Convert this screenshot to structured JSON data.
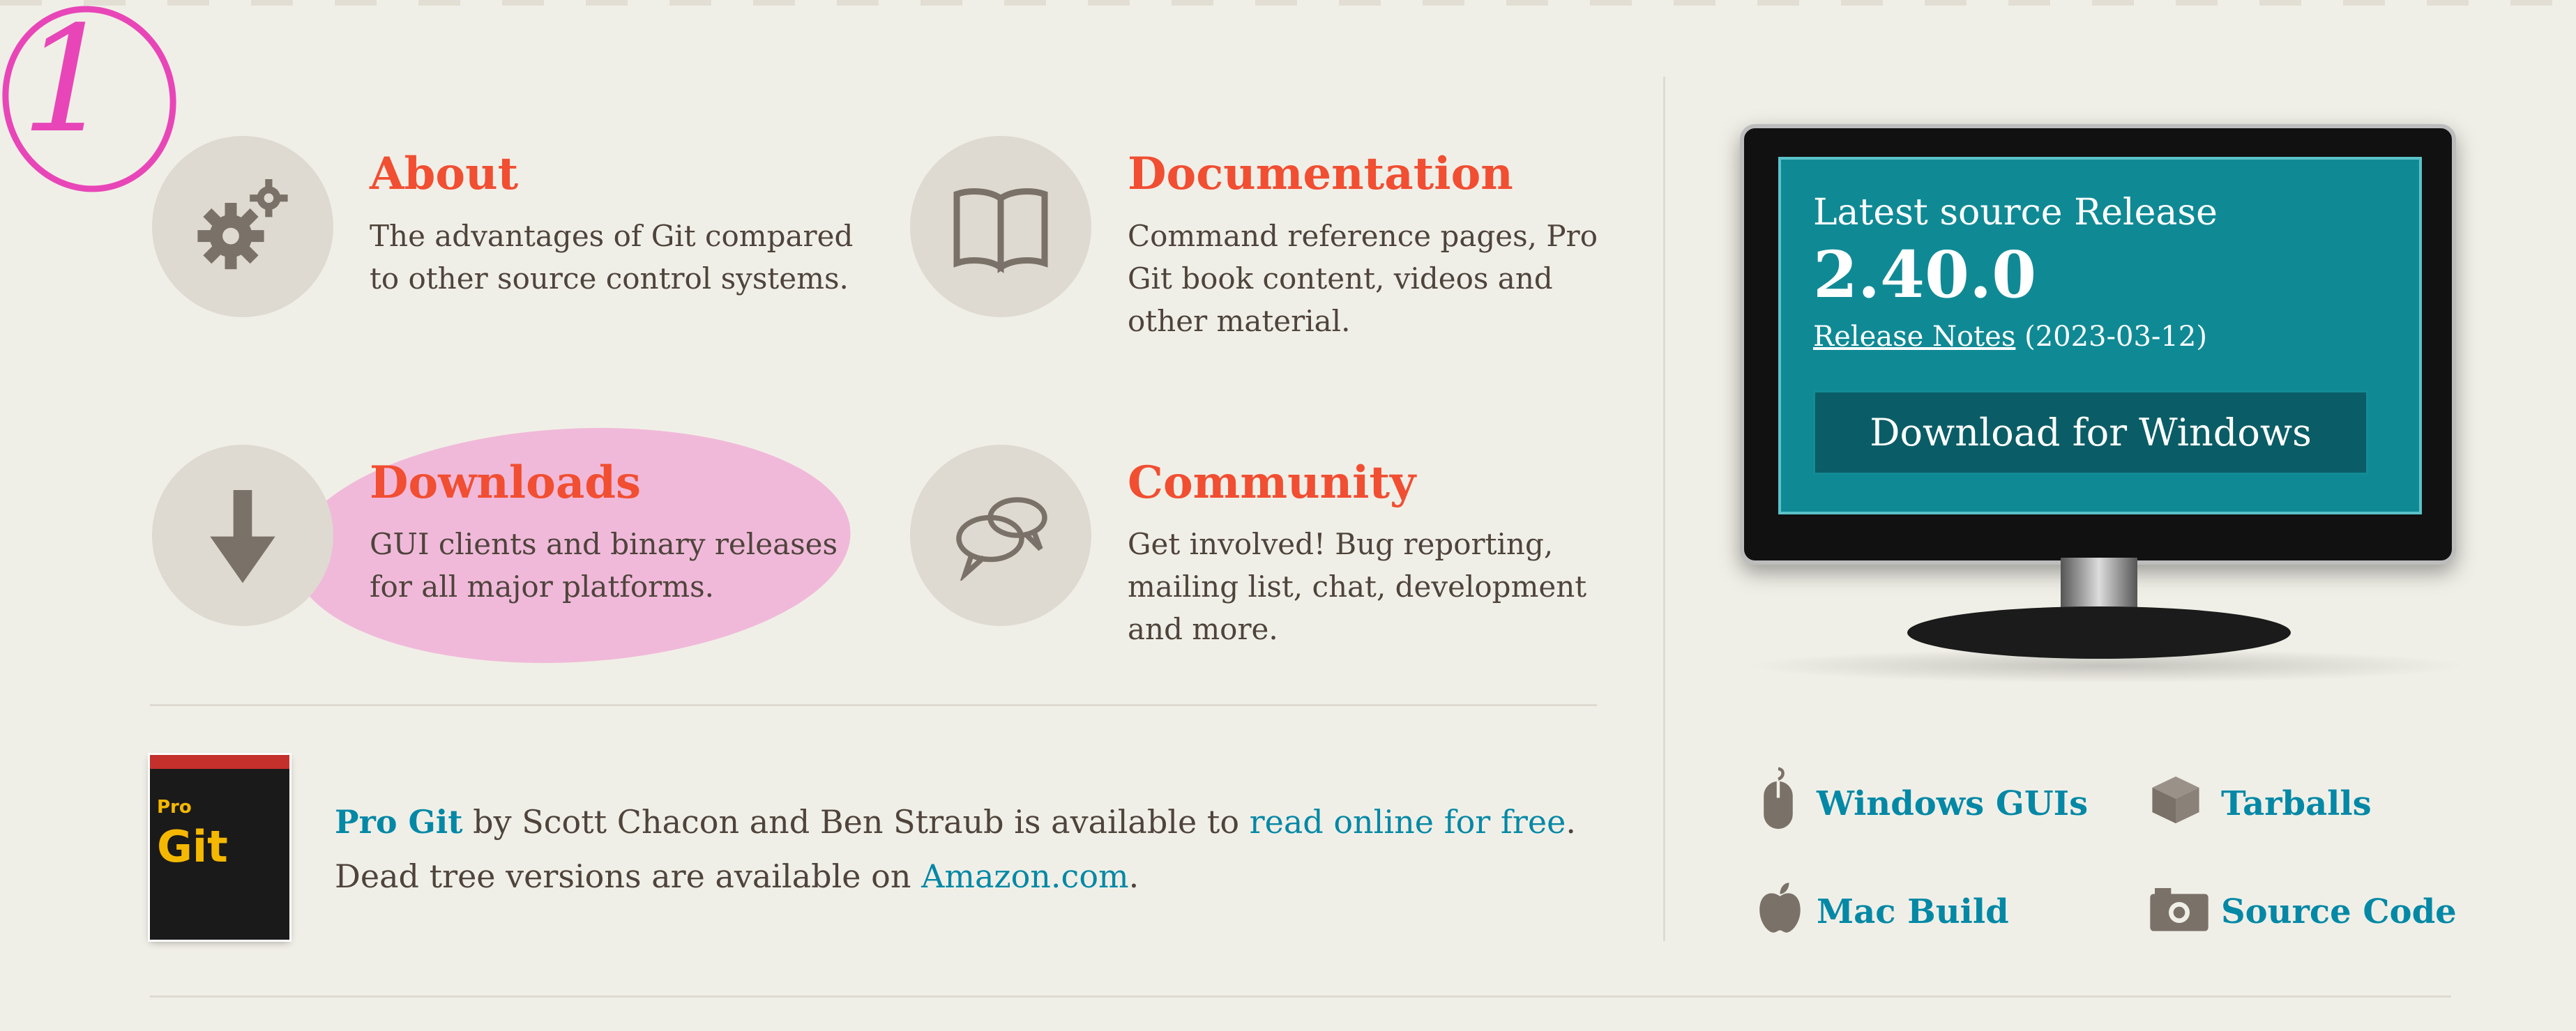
{
  "annotation": {
    "number": "1"
  },
  "features": [
    {
      "title": "About",
      "description": "The advantages of Git compared to other source control systems.",
      "icon": "gears-icon"
    },
    {
      "title": "Documentation",
      "description": "Command reference pages, Pro Git book content, videos and other material.",
      "icon": "book-icon"
    },
    {
      "title": "Downloads",
      "description": "GUI clients and binary releases for all major platforms.",
      "icon": "download-arrow-icon"
    },
    {
      "title": "Community",
      "description": "Get involved! Bug reporting, mailing list, chat, development and more.",
      "icon": "chat-bubbles-icon"
    }
  ],
  "progit": {
    "book_title": "Pro Git",
    "cover_small": "Pro",
    "cover_big": "Git",
    "text1": " by Scott Chacon and Ben Straub is available to ",
    "link_online": "read online for free",
    "text2": ". Dead tree versions are available on ",
    "link_amazon": "Amazon.com",
    "text3": "."
  },
  "release": {
    "label": "Latest source Release",
    "version": "2.40.0",
    "notes_link": "Release Notes",
    "date": " (2023-03-12)",
    "download_button": "Download for Windows"
  },
  "download_links": [
    {
      "label": "Windows GUIs",
      "icon": "mouse-icon"
    },
    {
      "label": "Tarballs",
      "icon": "box-icon"
    },
    {
      "label": "Mac Build",
      "icon": "apple-icon"
    },
    {
      "label": "Source Code",
      "icon": "camera-icon"
    }
  ],
  "colors": {
    "accent": "#f14e32",
    "link": "#0388a6",
    "screen": "#0f8a95",
    "annotation": "#e846b8"
  }
}
